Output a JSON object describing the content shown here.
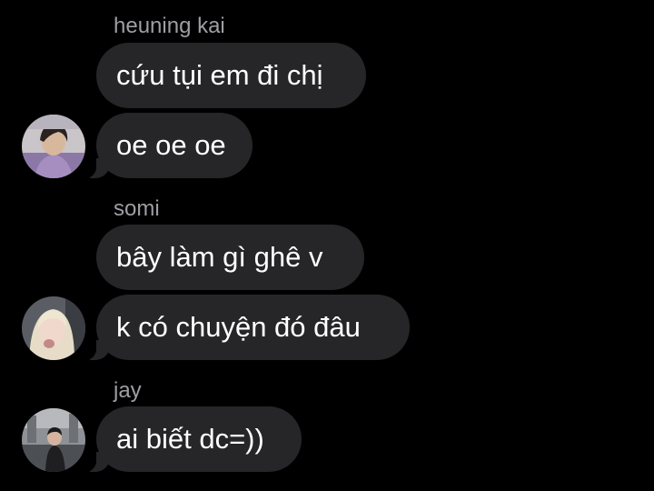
{
  "chat": {
    "groups": [
      {
        "sender": "heuning kai",
        "avatar_icon": "profile-photo-icon",
        "messages": [
          "cứu tụi em đi chị",
          "oe oe oe"
        ]
      },
      {
        "sender": "somi",
        "avatar_icon": "profile-photo-icon",
        "messages": [
          "bây làm gì ghê v",
          "k có chuyện đó đâu"
        ]
      },
      {
        "sender": "jay",
        "avatar_icon": "profile-photo-icon",
        "messages": [
          "ai biết dc=))"
        ]
      }
    ]
  },
  "colors": {
    "background": "#000000",
    "bubble": "#262628",
    "text": "#ffffff",
    "sender_name": "#9e9ea3"
  }
}
